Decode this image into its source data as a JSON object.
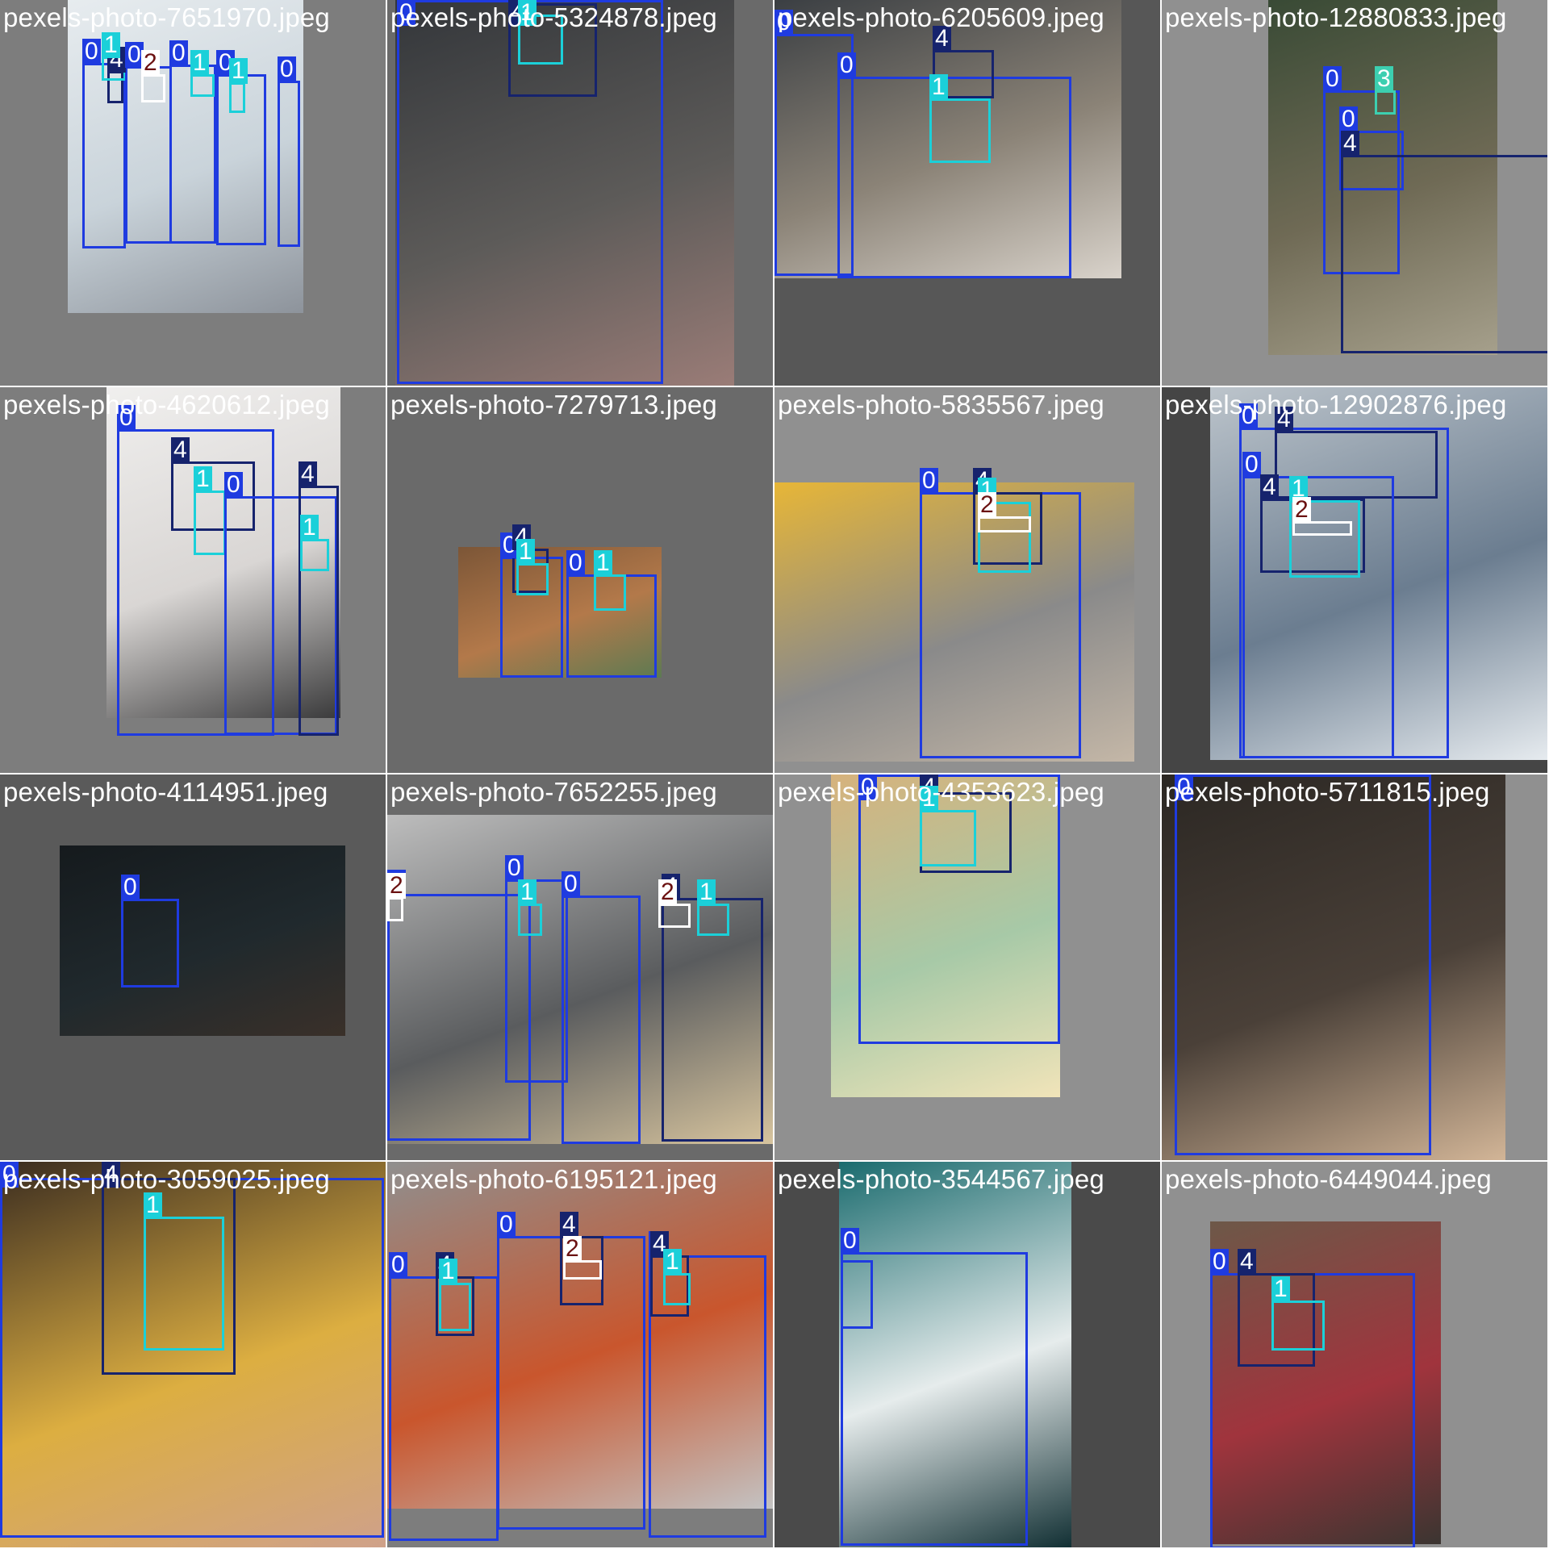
{
  "tiles": [
    {
      "file": "pexels-photo-7651970.jpeg",
      "bg": "#7d7d7d",
      "photo_colors": [
        "#e7ecef",
        "#c9d3da",
        "#8d939b"
      ],
      "labels": [
        "0",
        "4",
        "1",
        "0",
        "2",
        "0",
        "1",
        "0",
        "1",
        "0"
      ]
    },
    {
      "file": "pexels-photo-5324878.jpeg",
      "bg": "#6a6a6a",
      "photo_colors": [
        "#33363a",
        "#5d5b59",
        "#9a7c77"
      ],
      "labels": [
        "0",
        "4",
        "1"
      ]
    },
    {
      "file": "pexels-photo-6205609.jpeg",
      "bg": "#575757",
      "photo_colors": [
        "#3b3f43",
        "#8b8377",
        "#d9d3cb"
      ],
      "labels": [
        "0",
        "0",
        "4",
        "1"
      ]
    },
    {
      "file": "pexels-photo-12880833.jpeg",
      "bg": "#909090",
      "photo_colors": [
        "#394a35",
        "#6f6a55",
        "#a6a08c"
      ],
      "labels": [
        "0",
        "3",
        "0",
        "4"
      ]
    },
    {
      "file": "pexels-photo-4620612.jpeg",
      "bg": "#7d7d7d",
      "photo_colors": [
        "#f0efee",
        "#d9d6d4",
        "#3a3a3b"
      ],
      "labels": [
        "0",
        "4",
        "1",
        "0",
        "4",
        "1"
      ]
    },
    {
      "file": "pexels-photo-7279713.jpeg",
      "bg": "#6a6a6a",
      "photo_colors": [
        "#7c5637",
        "#b3794a",
        "#5d7a52"
      ],
      "labels": [
        "0",
        "4",
        "1",
        "0",
        "1"
      ]
    },
    {
      "file": "pexels-photo-5835567.jpeg",
      "bg": "#909090",
      "photo_colors": [
        "#e7b637",
        "#8a8a8a",
        "#c4b7a7"
      ],
      "labels": [
        "0",
        "4",
        "1",
        "2"
      ]
    },
    {
      "file": "pexels-photo-12902876.jpeg",
      "bg": "#454545",
      "photo_colors": [
        "#bcc4cb",
        "#6b7d90",
        "#e6ebef"
      ],
      "labels": [
        "0",
        "4",
        "0",
        "4",
        "1",
        "2"
      ]
    },
    {
      "file": "pexels-photo-4114951.jpeg",
      "bg": "#5a5a5a",
      "photo_colors": [
        "#151a1d",
        "#20292d",
        "#3a3029"
      ],
      "labels": [
        "0"
      ]
    },
    {
      "file": "pexels-photo-7652255.jpeg",
      "bg": "#6a6a6a",
      "photo_colors": [
        "#bdbdbd",
        "#5a5c5e",
        "#d7c49e"
      ],
      "labels": [
        "0",
        "2",
        "0",
        "1",
        "0",
        "4",
        "2",
        "1"
      ]
    },
    {
      "file": "pexels-photo-4353623.jpeg",
      "bg": "#909090",
      "photo_colors": [
        "#d6b27c",
        "#a7c9a7",
        "#f1e4b9"
      ],
      "labels": [
        "0",
        "4",
        "1"
      ]
    },
    {
      "file": "pexels-photo-5711815.jpeg",
      "bg": "#909090",
      "photo_colors": [
        "#2b2723",
        "#4a4038",
        "#d2b597"
      ],
      "labels": [
        "0"
      ]
    },
    {
      "file": "pexels-photo-3059025.jpeg",
      "bg": "#8c8c8c",
      "photo_colors": [
        "#3a2c20",
        "#dcae41",
        "#cfa18a"
      ],
      "labels": [
        "0",
        "4",
        "1"
      ]
    },
    {
      "file": "pexels-photo-6195121.jpeg",
      "bg": "#7d7d7d",
      "photo_colors": [
        "#8f8f8f",
        "#c9562d",
        "#c3c3c3"
      ],
      "labels": [
        "0",
        "4",
        "1",
        "0",
        "4",
        "2",
        "0",
        "4",
        "1"
      ]
    },
    {
      "file": "pexels-photo-3544567.jpeg",
      "bg": "#4a4a4a",
      "photo_colors": [
        "#1a6b6e",
        "#e6ecec",
        "#123034"
      ],
      "labels": [
        "0"
      ]
    },
    {
      "file": "pexels-photo-6449044.jpeg",
      "bg": "#909090",
      "photo_colors": [
        "#6d5848",
        "#a0343d",
        "#3b3531"
      ],
      "labels": [
        "0",
        "4",
        "1"
      ]
    }
  ]
}
